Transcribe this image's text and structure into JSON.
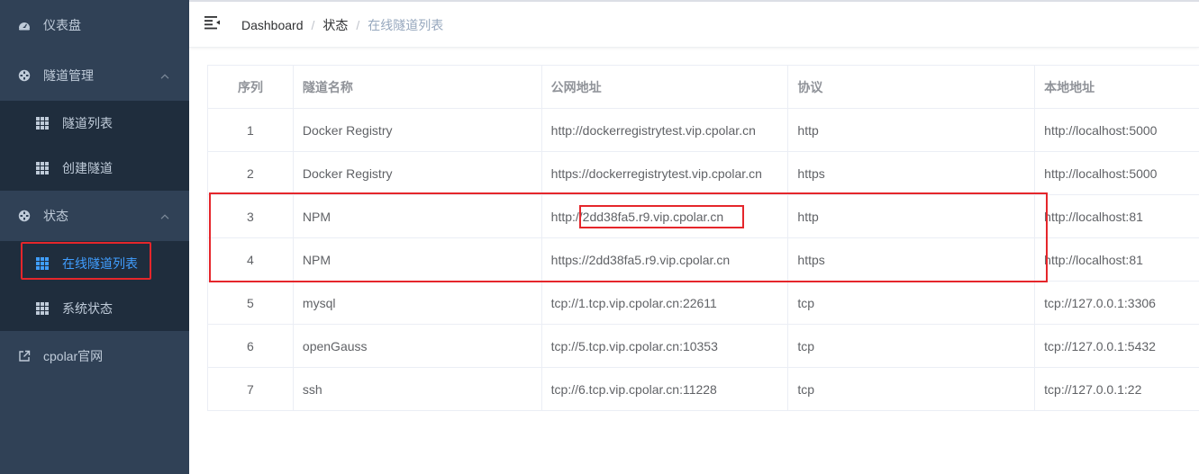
{
  "sidebar": {
    "dashboard": {
      "label": "仪表盘",
      "icon": "dashboard-icon"
    },
    "tunnel_management": {
      "label": "隧道管理",
      "icon": "circle-cross-icon",
      "items": [
        {
          "label": "隧道列表",
          "icon": "grid-icon"
        },
        {
          "label": "创建隧道",
          "icon": "grid-icon"
        }
      ]
    },
    "status": {
      "label": "状态",
      "icon": "circle-cross-icon",
      "items": [
        {
          "label": "在线隧道列表",
          "icon": "grid-icon",
          "active": true
        },
        {
          "label": "系统状态",
          "icon": "grid-icon"
        }
      ]
    },
    "website": {
      "label": "cpolar官网",
      "icon": "external-link-icon"
    }
  },
  "header": {
    "breadcrumb": [
      "Dashboard",
      "状态",
      "在线隧道列表"
    ]
  },
  "table": {
    "columns": [
      "序列",
      "隧道名称",
      "公网地址",
      "协议",
      "本地地址"
    ],
    "rows": [
      {
        "index": "1",
        "name": "Docker Registry",
        "public": "http://dockerregistrytest.vip.cpolar.cn",
        "protocol": "http",
        "local": "http://localhost:5000"
      },
      {
        "index": "2",
        "name": "Docker Registry",
        "public": "https://dockerregistrytest.vip.cpolar.cn",
        "protocol": "https",
        "local": "http://localhost:5000"
      },
      {
        "index": "3",
        "name": "NPM",
        "public": "http://2dd38fa5.r9.vip.cpolar.cn",
        "protocol": "http",
        "local": "http://localhost:81"
      },
      {
        "index": "4",
        "name": "NPM",
        "public": "https://2dd38fa5.r9.vip.cpolar.cn",
        "protocol": "https",
        "local": "http://localhost:81"
      },
      {
        "index": "5",
        "name": "mysql",
        "public": "tcp://1.tcp.vip.cpolar.cn:22611",
        "protocol": "tcp",
        "local": "tcp://127.0.0.1:3306"
      },
      {
        "index": "6",
        "name": "openGauss",
        "public": "tcp://5.tcp.vip.cpolar.cn:10353",
        "protocol": "tcp",
        "local": "tcp://127.0.0.1:5432"
      },
      {
        "index": "7",
        "name": "ssh",
        "public": "tcp://6.tcp.vip.cpolar.cn:11228",
        "protocol": "tcp",
        "local": "tcp://127.0.0.1:22"
      }
    ]
  },
  "colors": {
    "sidebar_bg": "#304156",
    "submenu_bg": "#1f2d3d",
    "active": "#409eff",
    "annotation": "#e5262b"
  }
}
